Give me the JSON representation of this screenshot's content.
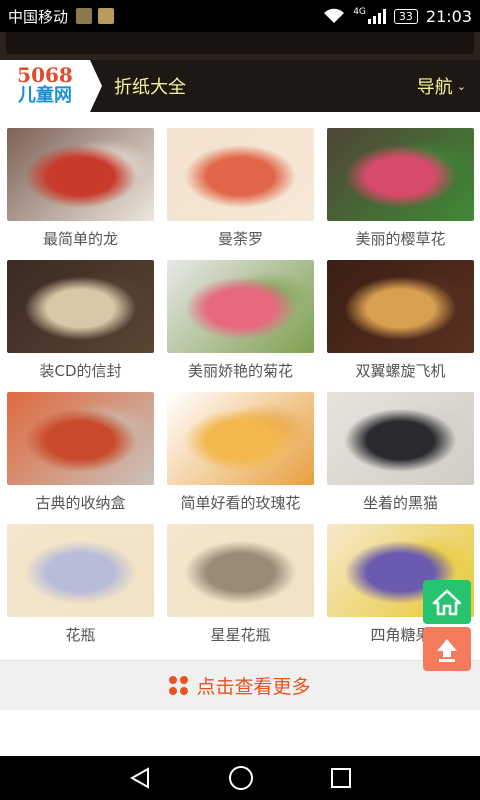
{
  "status_bar": {
    "carrier": "中国移动",
    "network": "4G",
    "battery": "33",
    "time": "21:03"
  },
  "header": {
    "logo_number": "5068",
    "logo_text": "儿童网",
    "title": "折纸大全",
    "nav_label": "导航",
    "nav_icon": "chevron-down-icon"
  },
  "items": [
    {
      "caption": "最简单的龙",
      "colors": [
        "#7d6256",
        "#c93a2a",
        "#ede6dc"
      ]
    },
    {
      "caption": "曼荼罗",
      "colors": [
        "#f2e2cf",
        "#e2674a",
        "#f6e8d6"
      ]
    },
    {
      "caption": "美丽的樱草花",
      "colors": [
        "#4f4436",
        "#d84a6a",
        "#3f8a35"
      ]
    },
    {
      "caption": "装CD的信封",
      "colors": [
        "#3a2a22",
        "#d8c8a8",
        "#5a4534"
      ]
    },
    {
      "caption": "美丽娇艳的菊花",
      "colors": [
        "#e8e8e8",
        "#e86880",
        "#7ea050"
      ]
    },
    {
      "caption": "双翼螺旋飞机",
      "colors": [
        "#3a1e14",
        "#d8a050",
        "#5a3020"
      ]
    },
    {
      "caption": "古典的收纳盒",
      "colors": [
        "#e06a40",
        "#c94a2a",
        "#c8c2ba"
      ]
    },
    {
      "caption": "简单好看的玫瑰花",
      "colors": [
        "#ffffff",
        "#f2b84e",
        "#e8a040"
      ]
    },
    {
      "caption": "坐着的黑猫",
      "colors": [
        "#e6e2dc",
        "#2a2a2e",
        "#d0ccc6"
      ]
    },
    {
      "caption": "花瓶",
      "colors": [
        "#f4e6cc",
        "#b8bcd8",
        "#f0e2c4"
      ]
    },
    {
      "caption": "星星花瓶",
      "colors": [
        "#f4e6cc",
        "#9a8a78",
        "#f0e2c4"
      ]
    },
    {
      "caption": "四角糖果",
      "colors": [
        "#f6e8cc",
        "#6a5ab0",
        "#e8c830"
      ]
    }
  ],
  "more_button": {
    "label": "点击查看更多"
  },
  "floating": {
    "home_icon": "home-icon",
    "top_icon": "arrow-up-icon"
  },
  "nav_bar": {
    "back_icon": "back-triangle-icon",
    "home_icon": "home-circle-icon",
    "recents_icon": "recents-square-icon"
  }
}
